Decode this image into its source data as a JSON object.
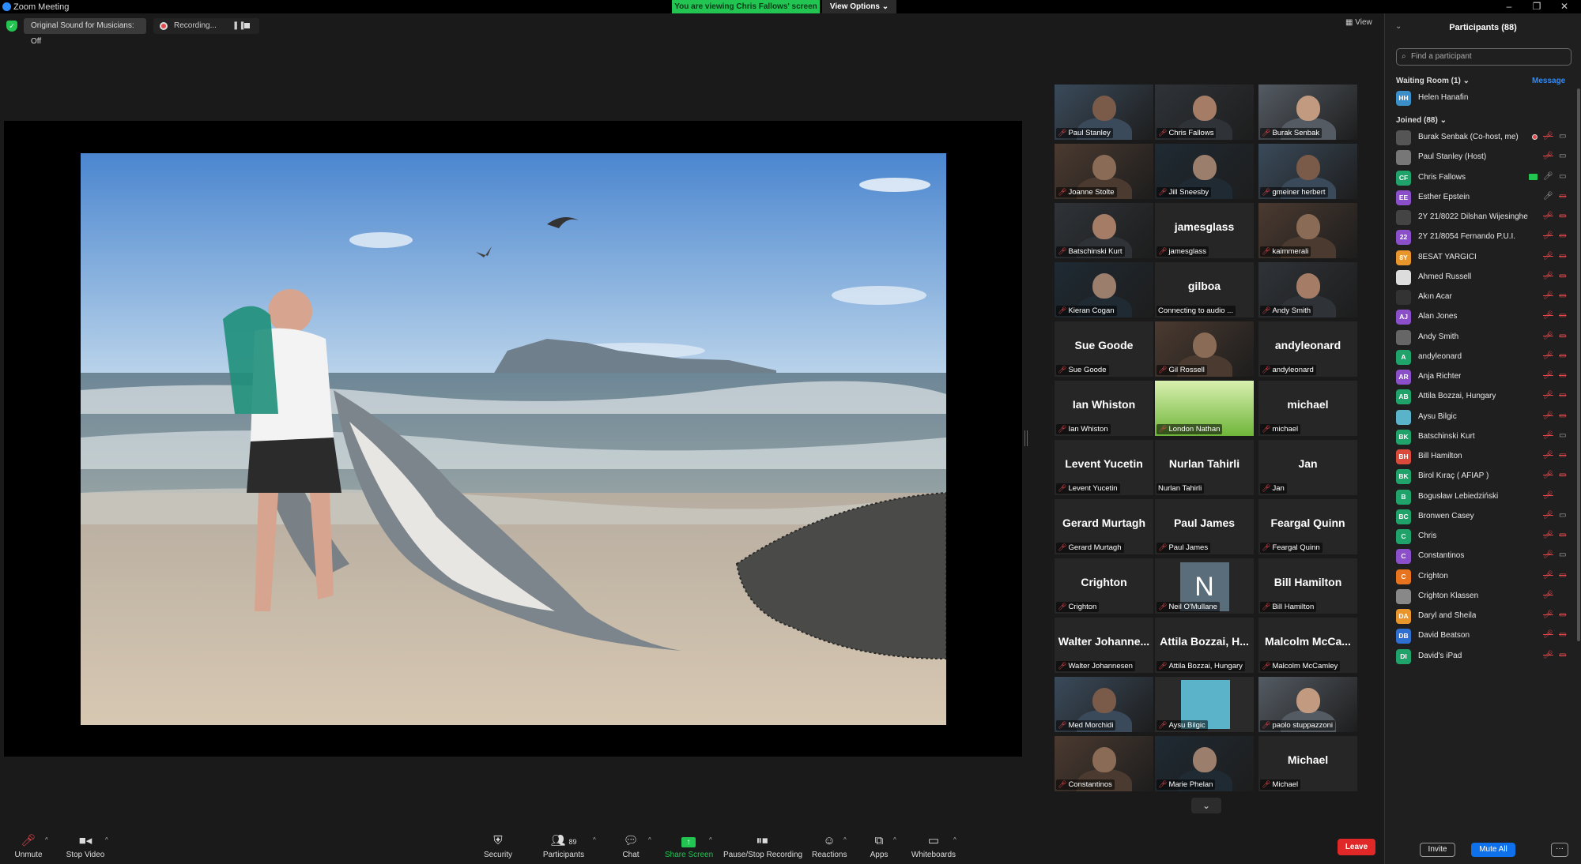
{
  "window": {
    "title": "Zoom Meeting"
  },
  "banner": {
    "viewing_text": "You are viewing Chris Fallows' screen",
    "view_options_label": "View Options"
  },
  "top_controls": {
    "original_sound": "Original Sound for Musicians: Off",
    "recording": "Recording...",
    "view_label": "View"
  },
  "gallery": [
    {
      "name": "Paul Stanley",
      "display": "",
      "video": true
    },
    {
      "name": "Chris Fallows",
      "display": "",
      "video": true,
      "active": true
    },
    {
      "name": "Burak Senbak",
      "display": "",
      "video": true
    },
    {
      "name": "Joanne Stolte",
      "display": "",
      "video": true
    },
    {
      "name": "Jill Sneesby",
      "display": "",
      "video": true
    },
    {
      "name": "gmeiner herbert",
      "display": "",
      "video": true
    },
    {
      "name": "Batschinski Kurt",
      "display": "",
      "video": true
    },
    {
      "name": "jamesglass",
      "display": "jamesglass",
      "video": false
    },
    {
      "name": "kaimmerali",
      "display": "",
      "video": true
    },
    {
      "name": "Kieran Cogan",
      "display": "",
      "video": true
    },
    {
      "name": "Connecting to audio ...",
      "display": "gilboa",
      "video": false,
      "nomic": true
    },
    {
      "name": "Andy Smith",
      "display": "",
      "video": true
    },
    {
      "name": "Sue Goode",
      "display": "Sue Goode",
      "video": false
    },
    {
      "name": "Gil Rossell",
      "display": "",
      "video": true
    },
    {
      "name": "andyleonard",
      "display": "andyleonard",
      "video": false
    },
    {
      "name": "Ian Whiston",
      "display": "Ian Whiston",
      "video": false
    },
    {
      "name": "London Nathan",
      "display": "",
      "video": true,
      "grass": true
    },
    {
      "name": "michael",
      "display": "michael",
      "video": false
    },
    {
      "name": "Levent Yucetin",
      "display": "Levent Yucetin",
      "video": false
    },
    {
      "name": "Nurlan Tahirli",
      "display": "Nurlan Tahirli",
      "video": false,
      "nomic": true
    },
    {
      "name": "Jan",
      "display": "Jan",
      "video": false
    },
    {
      "name": "Gerard Murtagh",
      "display": "Gerard Murtagh",
      "video": false
    },
    {
      "name": "Paul James",
      "display": "Paul James",
      "video": false
    },
    {
      "name": "Feargal Quinn",
      "display": "Feargal Quinn",
      "video": false
    },
    {
      "name": "Crighton",
      "display": "Crighton",
      "video": false
    },
    {
      "name": "Neil O'Mullane",
      "display": "",
      "video": false,
      "letter": "N"
    },
    {
      "name": "Bill Hamilton",
      "display": "Bill Hamilton",
      "video": false
    },
    {
      "name": "Walter Johannesen",
      "display": "Walter  Johanne...",
      "video": false
    },
    {
      "name": "Attila Bozzai, Hungary",
      "display": "Attila Bozzai, H...",
      "video": false
    },
    {
      "name": "Malcolm McCamley",
      "display": "Malcolm  McCa...",
      "video": false
    },
    {
      "name": "Med Morchidi",
      "display": "",
      "video": true
    },
    {
      "name": "Aysu Bilgic",
      "display": "",
      "video": true,
      "teal": true
    },
    {
      "name": "paolo stuppazzoni",
      "display": "",
      "video": true
    },
    {
      "name": "Constantinos",
      "display": "",
      "video": true
    },
    {
      "name": "Marie Phelan",
      "display": "",
      "video": true
    },
    {
      "name": "Michael",
      "display": "Michael",
      "video": false
    }
  ],
  "participants_panel": {
    "title": "Participants (88)",
    "search_placeholder": "Find a participant",
    "waiting_room_label": "Waiting Room (1)",
    "message_label": "Message",
    "waiting": [
      {
        "initials": "HH",
        "name": "Helen Hanafin",
        "color": "#3a8fc8"
      }
    ],
    "joined_label": "Joined (88)",
    "joined": [
      {
        "initials": "",
        "name": "Burak Senbak (Co-host, me)",
        "color": "#555",
        "mic": "muted",
        "video": "on",
        "rec": true
      },
      {
        "initials": "",
        "name": "Paul Stanley (Host)",
        "color": "#777",
        "mic": "muted",
        "video": "on"
      },
      {
        "initials": "CF",
        "name": "Chris Fallows",
        "color": "#1fa36a",
        "mic": "on",
        "video": "on",
        "sharing": true
      },
      {
        "initials": "EE",
        "name": "Esther Epstein",
        "color": "#8a4fc9",
        "mic": "on",
        "video": "off"
      },
      {
        "initials": "",
        "name": "2Y 21/8022 Dilshan Wijesinghe",
        "color": "#444",
        "mic": "muted",
        "video": "off"
      },
      {
        "initials": "22",
        "name": "2Y 21/8054 Fernando P.U.I.",
        "color": "#8a4fc9",
        "mic": "muted",
        "video": "off"
      },
      {
        "initials": "8Y",
        "name": "8ESAT YARGICI",
        "color": "#e8962b",
        "mic": "muted",
        "video": "off"
      },
      {
        "initials": "",
        "name": "Ahmed Russell",
        "color": "#ddd",
        "mic": "muted",
        "video": "off"
      },
      {
        "initials": "",
        "name": "Akın Acar",
        "color": "#333",
        "mic": "muted",
        "video": "off"
      },
      {
        "initials": "AJ",
        "name": "Alan Jones",
        "color": "#8a4fc9",
        "mic": "muted",
        "video": "off"
      },
      {
        "initials": "",
        "name": "Andy Smith",
        "color": "#666",
        "mic": "muted",
        "video": "off"
      },
      {
        "initials": "A",
        "name": "andyleonard",
        "color": "#1fa36a",
        "mic": "muted",
        "video": "off"
      },
      {
        "initials": "AR",
        "name": "Anja Richter",
        "color": "#8a4fc9",
        "mic": "muted",
        "video": "off"
      },
      {
        "initials": "AB",
        "name": "Attila Bozzai, Hungary",
        "color": "#1fa36a",
        "mic": "muted",
        "video": "off"
      },
      {
        "initials": "",
        "name": "Aysu Bilgic",
        "color": "#5ab3c9",
        "mic": "muted",
        "video": "off"
      },
      {
        "initials": "BK",
        "name": "Batschinski Kurt",
        "color": "#1fa36a",
        "mic": "muted",
        "video": "on"
      },
      {
        "initials": "BH",
        "name": "Bill Hamilton",
        "color": "#d94a3a",
        "mic": "muted",
        "video": "off"
      },
      {
        "initials": "BK",
        "name": "Birol Kıraç  ( AFIAP )",
        "color": "#1fa36a",
        "mic": "muted",
        "video": "off"
      },
      {
        "initials": "B",
        "name": "Bogusław Lebiedziński",
        "color": "#1fa36a",
        "mic": "muted",
        "video": ""
      },
      {
        "initials": "BC",
        "name": "Bronwen Casey",
        "color": "#1fa36a",
        "mic": "muted",
        "video": "on"
      },
      {
        "initials": "C",
        "name": "Chris",
        "color": "#1fa36a",
        "mic": "muted",
        "video": "off"
      },
      {
        "initials": "C",
        "name": "Constantinos",
        "color": "#8a4fc9",
        "mic": "muted",
        "video": "on"
      },
      {
        "initials": "C",
        "name": "Crighton",
        "color": "#e8731f",
        "mic": "muted",
        "video": "off"
      },
      {
        "initials": "",
        "name": "Crighton Klassen",
        "color": "#888",
        "mic": "muted",
        "video": ""
      },
      {
        "initials": "DA",
        "name": "Daryl and Sheila",
        "color": "#e8962b",
        "mic": "muted",
        "video": "off"
      },
      {
        "initials": "DB",
        "name": "David Beatson",
        "color": "#2f6fd0",
        "mic": "muted",
        "video": "off"
      },
      {
        "initials": "DI",
        "name": "David's iPad",
        "color": "#1fa36a",
        "mic": "muted",
        "video": "off"
      }
    ],
    "invite_label": "Invite",
    "mute_all_label": "Mute All",
    "more_label": "···"
  },
  "toolbar": {
    "unmute": "Unmute",
    "stop_video": "Stop Video",
    "security": "Security",
    "participants": "Participants",
    "participants_count": "89",
    "chat": "Chat",
    "share_screen": "Share Screen",
    "pause_recording": "Pause/Stop Recording",
    "reactions": "Reactions",
    "apps": "Apps",
    "whiteboards": "Whiteboards",
    "leave": "Leave"
  },
  "colors": {
    "accent": "#0e71eb",
    "banner_green": "#23c552",
    "leave_red": "#e02828",
    "muted_red": "#e5484d"
  }
}
